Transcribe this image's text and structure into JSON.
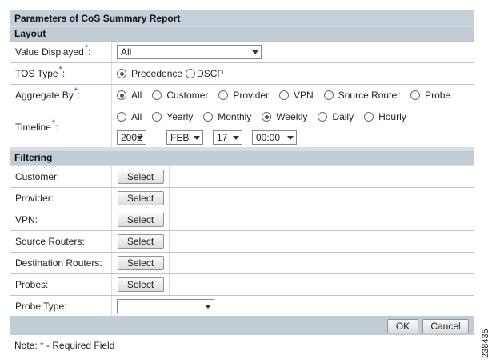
{
  "header": {
    "title": "Parameters of CoS Summary Report"
  },
  "layout": {
    "section_label": "Layout",
    "required_marker": "*",
    "value_displayed": {
      "label": "Value Displayed",
      "suffix": ":",
      "value": "All"
    },
    "tos_type": {
      "label": "TOS Type",
      "suffix": ":",
      "options": [
        "Precedence",
        "DSCP"
      ],
      "selected": "Precedence"
    },
    "aggregate_by": {
      "label": "Aggregate By",
      "suffix": ":",
      "options": [
        "All",
        "Customer",
        "Provider",
        "VPN",
        "Source Router",
        "Probe"
      ],
      "selected": "All"
    },
    "timeline": {
      "label": "Timeline",
      "suffix": ":",
      "options": [
        "All",
        "Yearly",
        "Monthly",
        "Weekly",
        "Daily",
        "Hourly"
      ],
      "selected": "Weekly",
      "year": "2002",
      "month": "FEB",
      "day": "17",
      "time": "00:00"
    }
  },
  "filtering": {
    "section_label": "Filtering",
    "select_button_label": "Select",
    "rows": [
      {
        "label": "Customer:"
      },
      {
        "label": "Provider:"
      },
      {
        "label": "VPN:"
      },
      {
        "label": "Source Routers:"
      },
      {
        "label": "Destination Routers:"
      },
      {
        "label": "Probes:"
      }
    ],
    "probe_type": {
      "label": "Probe Type:",
      "value": ""
    }
  },
  "actions": {
    "ok_label": "OK",
    "cancel_label": "Cancel"
  },
  "note": {
    "prefix": "Note: ",
    "star": "*",
    "text": " - Required Field"
  },
  "figure_id": "238435"
}
